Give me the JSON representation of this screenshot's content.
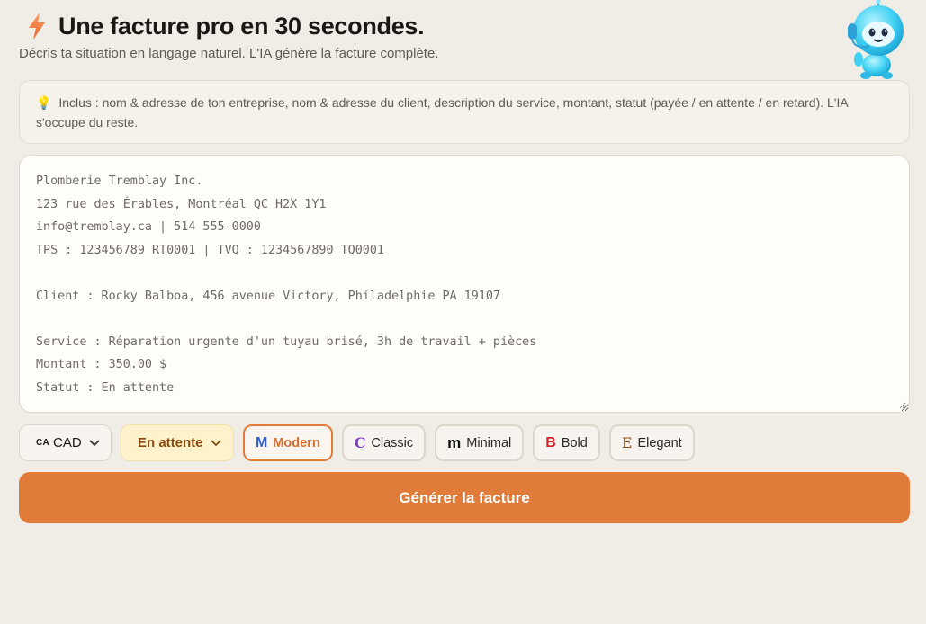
{
  "header": {
    "title": "Une facture pro en 30 secondes.",
    "subtitle": "Décris ta situation en langage naturel. L'IA génère la facture complète.",
    "bolt_icon": "lightning-bolt-icon",
    "mascot_icon": "robot-mascot-icon"
  },
  "info": {
    "icon": "💡",
    "text": "Inclus : nom & adresse de ton entreprise, nom & adresse du client, description du service, montant, statut (payée / en attente / en retard). L'IA s'occupe du reste."
  },
  "editor": {
    "value": "Plomberie Tremblay Inc.\n123 rue des Érables, Montréal QC H2X 1Y1\ninfo@tremblay.ca | 514 555-0000\nTPS : 123456789 RT0001 | TVQ : 1234567890 TQ0001\n\nClient : Rocky Balboa, 456 avenue Victory, Philadelphie PA 19107\n\nService : Réparation urgente d'un tuyau brisé, 3h de travail + pièces\nMontant : 350.00 $\nStatut : En attente"
  },
  "controls": {
    "currency": {
      "flag": "CA",
      "value": "CAD"
    },
    "status": {
      "value": "En attente"
    },
    "templates": [
      {
        "letter": "M",
        "label": "Modern",
        "color": "#2f5fd6",
        "active": true
      },
      {
        "letter": "C",
        "label": "Classic",
        "color": "#7b3fc9",
        "active": false
      },
      {
        "letter": "m",
        "label": "Minimal",
        "color": "#111111",
        "active": false
      },
      {
        "letter": "B",
        "label": "Bold",
        "color": "#d22a2a",
        "active": false
      },
      {
        "letter": "E",
        "label": "Elegant",
        "color": "#8a4a1c",
        "active": false
      }
    ]
  },
  "cta": {
    "label": "Générer la facture"
  },
  "colors": {
    "accent": "#e07b3a",
    "background": "#f0ece6"
  }
}
